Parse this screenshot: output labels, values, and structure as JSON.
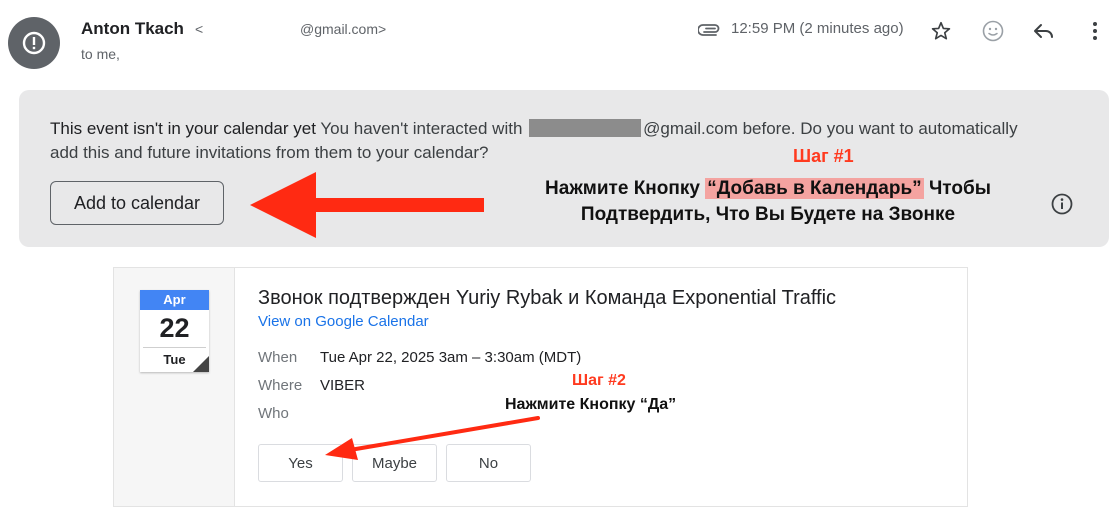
{
  "header": {
    "sender_name": "Anton Tkach",
    "sender_lt": "<",
    "sender_email_visible": "@gmail.com>",
    "to_line": "to me,",
    "time": "12:59 PM (2 minutes ago)",
    "icons": [
      "avatar-alert-icon",
      "paperclip-icon",
      "star-icon",
      "emoji-icon",
      "reply-icon",
      "more-vert-icon"
    ]
  },
  "banner": {
    "bold": "This event isn't in your calendar yet",
    "text1": "You haven't interacted with",
    "text2": "@gmail.com before. Do you want to automatically add this and future invitations from them to your calendar?",
    "add_button": "Add to calendar"
  },
  "annotations": {
    "step1_title": "Шаг #1",
    "step1_pre": "Нажмите Кнопку",
    "step1_highlight": "“Добавь в Календарь”",
    "step1_post": "Чтобы Подтвердить, Что Вы Будете на Звонке",
    "step2_title": "Шаг #2",
    "step2_instr": "Нажмите Кнопку “Да”",
    "arrow_color": "#ff2a12"
  },
  "event": {
    "cal_month": "Apr",
    "cal_day": "22",
    "cal_dow": "Tue",
    "title": "Звонок подтвержден Yuriy Rybak и Команда Exponential Traffic",
    "link": "View on Google Calendar",
    "when_label": "When",
    "when_value": "Tue Apr 22, 2025 3am – 3:30am (MDT)",
    "where_label": "Where",
    "where_value": "VIBER",
    "who_label": "Who",
    "rsvp": {
      "yes": "Yes",
      "maybe": "Maybe",
      "no": "No"
    }
  },
  "colors": {
    "avatar": "#5f6368",
    "banner_bg": "#e8e8e9",
    "calendar_blue": "#4285f4",
    "link_blue": "#1a73e8",
    "highlight": "#f4a3a0"
  }
}
